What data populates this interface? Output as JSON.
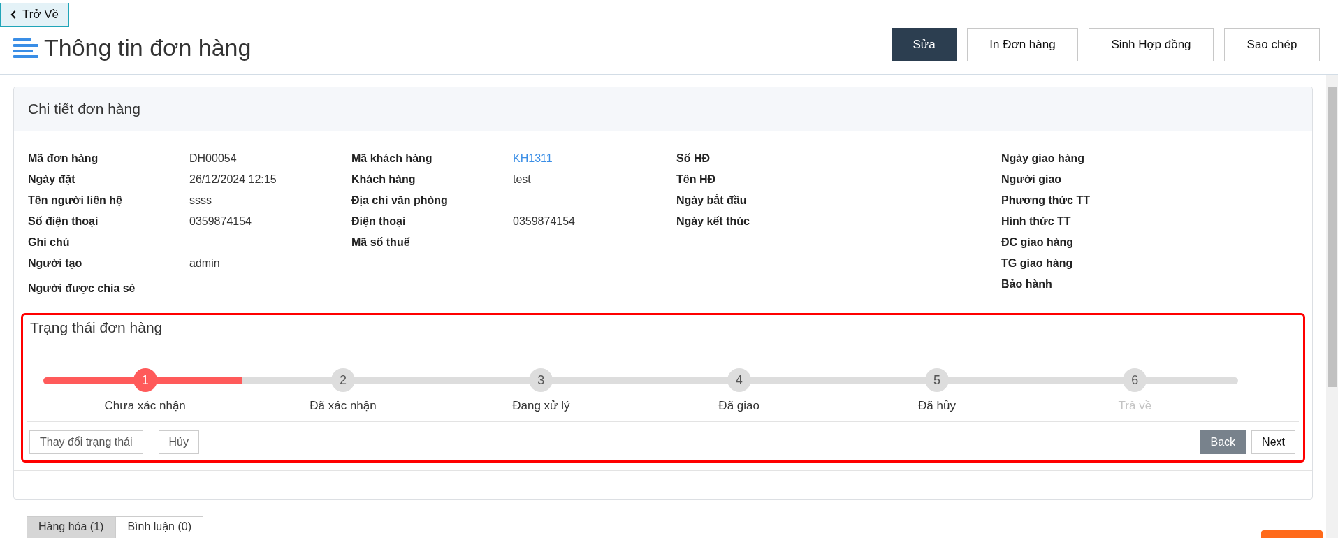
{
  "back_button": {
    "label": "Trở Về"
  },
  "page_title": "Thông tin đơn hàng",
  "actions": [
    {
      "label": "Sửa",
      "kind": "primary"
    },
    {
      "label": "In Đơn hàng",
      "kind": "default"
    },
    {
      "label": "Sinh Hợp đồng",
      "kind": "default"
    },
    {
      "label": "Sao chép",
      "kind": "default"
    }
  ],
  "order_detail": {
    "title": "Chi tiết đơn hàng",
    "groups": [
      {
        "fields": [
          {
            "label": "Mã đơn hàng",
            "value": "DH00054"
          },
          {
            "label": "Ngày đặt",
            "value": "26/12/2024 12:15"
          },
          {
            "label": "Tên người liên hệ",
            "value": "ssss"
          },
          {
            "label": "Số điện thoại",
            "value": "0359874154"
          },
          {
            "label": "Ghi chú"
          },
          {
            "label": "Người tạo",
            "value": "admin"
          },
          {
            "label": "Người được chia sẻ"
          }
        ]
      },
      {
        "fields": [
          {
            "label": "Mã khách hàng",
            "value": "KH1311",
            "link": true
          },
          {
            "label": "Khách hàng",
            "value": "test"
          },
          {
            "label": "Địa chỉ văn phòng"
          },
          {
            "label": "Điện thoại",
            "value": "0359874154"
          },
          {
            "label": "Mã số thuế"
          }
        ]
      },
      {
        "fields": [
          {
            "label": "Số HĐ"
          },
          {
            "label": "Tên HĐ"
          },
          {
            "label": "Ngày bắt đầu"
          },
          {
            "label": "Ngày kết thúc"
          }
        ]
      },
      {
        "fields": [
          {
            "label": "Ngày giao hàng"
          },
          {
            "label": "Người giao"
          },
          {
            "label": "Phương thức TT"
          },
          {
            "label": "Hình thức TT"
          },
          {
            "label": "ĐC giao hàng"
          },
          {
            "label": "TG giao hàng"
          },
          {
            "label": "Bảo hành"
          }
        ]
      }
    ]
  },
  "order_status": {
    "title": "Trạng thái đơn hàng",
    "steps": [
      {
        "number": "1",
        "label": "Chưa xác nhận",
        "selected": true,
        "disabled": false
      },
      {
        "number": "2",
        "label": "Đã xác nhận",
        "selected": false,
        "disabled": false
      },
      {
        "number": "3",
        "label": "Đang xử lý",
        "selected": false,
        "disabled": false
      },
      {
        "number": "4",
        "label": "Đã giao",
        "selected": false,
        "disabled": false
      },
      {
        "number": "5",
        "label": "Đã hủy",
        "selected": false,
        "disabled": false
      },
      {
        "number": "6",
        "label": "Trả về",
        "selected": false,
        "disabled": true
      }
    ],
    "left_buttons": [
      "Thay đổi trạng thái",
      "Hủy"
    ],
    "back_label": "Back",
    "next_label": "Next"
  },
  "bottom_tabs": [
    {
      "label": "Hàng hóa (1)",
      "selected": true
    },
    {
      "label": "Bình luận (0)",
      "selected": false
    }
  ]
}
